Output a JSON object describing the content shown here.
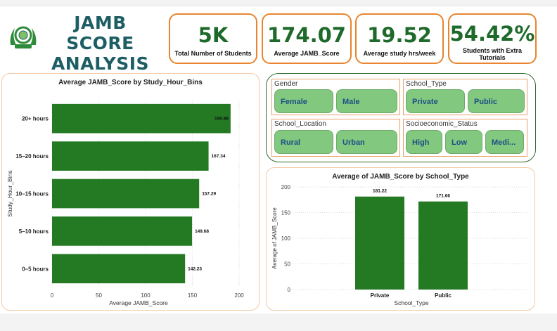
{
  "header": {
    "title": "JAMB SCORE ANALYSIS"
  },
  "kpis": [
    {
      "value": "5K",
      "label": "Total Number of Students"
    },
    {
      "value": "174.07",
      "label": "Average JAMB_Score"
    },
    {
      "value": "19.52",
      "label": "Average study hrs/week"
    },
    {
      "value": "54.42%",
      "label": "Students with Extra Tutorials"
    }
  ],
  "slicers": {
    "gender": {
      "title": "Gender",
      "options": [
        "Female",
        "Male"
      ]
    },
    "school_type": {
      "title": "School_Type",
      "options": [
        "Private",
        "Public"
      ]
    },
    "school_location": {
      "title": "School_Location",
      "options": [
        "Rural",
        "Urban"
      ]
    },
    "socioeconomic_status": {
      "title": "Socioeconomic_Status",
      "options": [
        "High",
        "Low",
        "Medi..."
      ]
    }
  },
  "colors": {
    "bar": "#237a23",
    "accent": "#e8852e",
    "title": "#1d5e64"
  },
  "chart_data": [
    {
      "type": "bar",
      "orientation": "horizontal",
      "title": "Average JAMB_Score by Study_Hour_Bins",
      "xlabel": "Average JAMB_Score",
      "ylabel": "Study_Hour_Bins",
      "categories": [
        "20+ hours",
        "15–20 hours",
        "10–15 hours",
        "5–10 hours",
        "0–5 hours"
      ],
      "values": [
        190.88,
        167.34,
        157.29,
        149.68,
        142.23
      ],
      "data_labels": [
        "190.88",
        "167.34",
        "157.29",
        "149.68",
        "142.23"
      ],
      "xlim": [
        0,
        200
      ],
      "xticks": [
        "0",
        "50",
        "100",
        "150",
        "200"
      ],
      "grid": true
    },
    {
      "type": "bar",
      "title": "Average of JAMB_Score by School_Type",
      "xlabel": "School_Type",
      "ylabel": "Average of JAMB_Score",
      "categories": [
        "Private",
        "Public"
      ],
      "values": [
        181.22,
        171.66
      ],
      "data_labels": [
        "181.22",
        "171.66"
      ],
      "ylim": [
        0,
        200
      ],
      "yticks": [
        "0",
        "50",
        "100",
        "150",
        "200"
      ],
      "grid": true
    }
  ]
}
